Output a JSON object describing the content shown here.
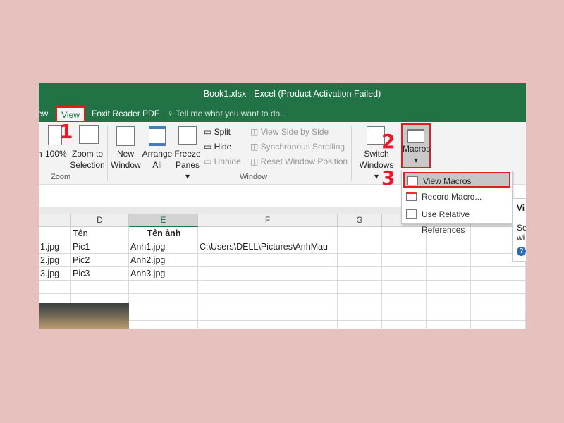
{
  "window": {
    "title": "Book1.xlsx - Excel (Product Activation Failed)"
  },
  "tabs": [
    {
      "label": "ew"
    },
    {
      "label": "View",
      "active": true
    },
    {
      "label": "Foxit Reader PDF"
    }
  ],
  "tell_me": {
    "placeholder": "Tell me what you want to do..."
  },
  "ribbon": {
    "zoom_group": {
      "label": "Zoom",
      "partial": "n",
      "btn_100": "100%",
      "zoom_sel_1": "Zoom to",
      "zoom_sel_2": "Selection"
    },
    "window_group": {
      "label": "Window",
      "new_1": "New",
      "new_2": "Window",
      "arrange_1": "Arrange",
      "arrange_2": "All",
      "freeze_1": "Freeze",
      "freeze_2": "Panes",
      "split": "Split",
      "hide": "Hide",
      "unhide": "Unhide",
      "side_by_side": "View Side by Side",
      "sync_scroll": "Synchronous Scrolling",
      "reset_pos": "Reset Window Position",
      "switch_1": "Switch",
      "switch_2": "Windows"
    },
    "macros": {
      "label": "Macros"
    }
  },
  "macros_menu": [
    {
      "label": "View Macros",
      "highlighted": true
    },
    {
      "label": "Record Macro..."
    },
    {
      "label": "Use Relative References"
    }
  ],
  "tooltip": {
    "title": "Vi",
    "line1": "Se",
    "line2": "wi"
  },
  "annotations": {
    "step1": "1",
    "step2": "2",
    "step3": "3",
    "color": "#e4192c"
  },
  "sheet": {
    "columns": [
      "",
      "D",
      "E",
      "F",
      "G",
      "",
      "",
      ""
    ],
    "selected_column": "E",
    "rows": [
      [
        "",
        "Tên",
        "Tên ảnh",
        ""
      ],
      [
        "1.jpg",
        "Pic1",
        "Anh1.jpg",
        "C:\\Users\\DELL\\Pictures\\AnhMau"
      ],
      [
        "2.jpg",
        "Pic2",
        "Anh2.jpg",
        ""
      ],
      [
        "3.jpg",
        "Pic3",
        "Anh3.jpg",
        ""
      ]
    ]
  },
  "colors": {
    "excel_green": "#217346",
    "background": "#e7c1bd"
  }
}
